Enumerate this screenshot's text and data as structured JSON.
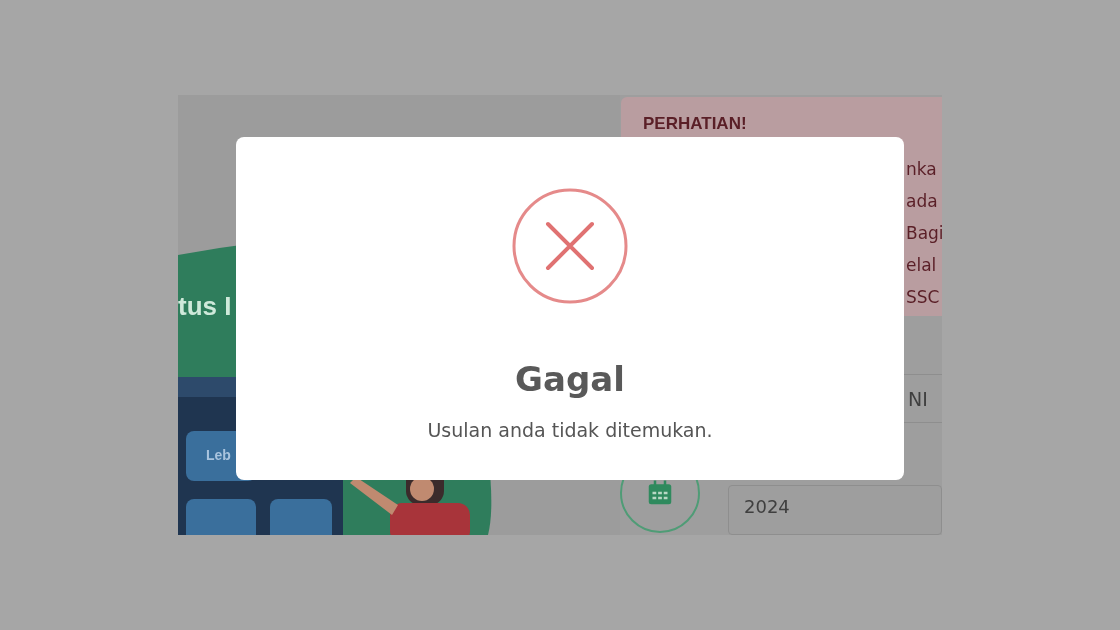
{
  "background_page": {
    "heading_fragment": "tus I",
    "phone_button": "Leb",
    "alert": {
      "title": "PERHATIAN!",
      "lines": [
        "nka",
        "ada",
        "Bagi",
        "elal",
        "SSC"
      ]
    },
    "field_fragment": "NI",
    "year_field": {
      "value": "2024"
    }
  },
  "dialog": {
    "kind": "error",
    "title": "Gagal",
    "message": "Usulan anda tidak ditemukan."
  }
}
